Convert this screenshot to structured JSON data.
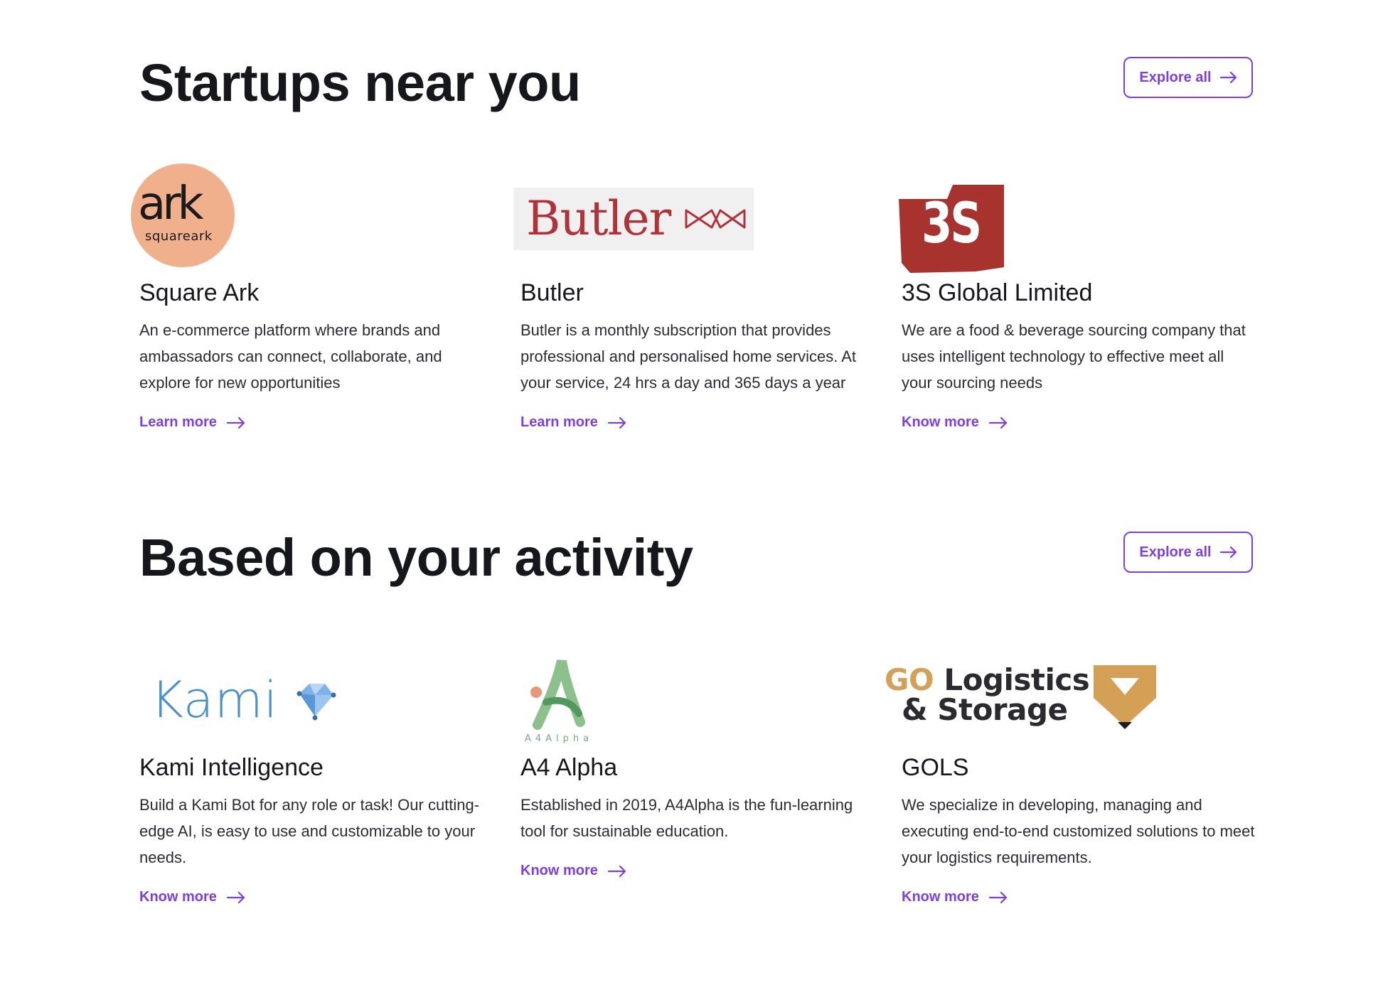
{
  "sections": [
    {
      "title": "Startups near you",
      "explore_label": "Explore all",
      "cards": [
        {
          "logo": {
            "primary": "ark",
            "secondary": "squareark"
          },
          "name": "Square Ark",
          "description": "An e-commerce platform where brands and ambassadors can connect, collaborate, and explore for new opportunities",
          "link_label": "Learn more"
        },
        {
          "logo": {
            "primary": "Butler"
          },
          "name": "Butler",
          "description": "Butler is a monthly subscription that provides professional and personalised home services. At your service, 24 hrs a day and 365 days a year",
          "link_label": "Learn more"
        },
        {
          "logo": {
            "primary": "3S"
          },
          "name": "3S Global Limited",
          "description": "We are a food & beverage sourcing company that uses intelligent technology to effective meet all your sourcing needs",
          "link_label": "Know more"
        }
      ]
    },
    {
      "title": "Based on your activity",
      "explore_label": "Explore all",
      "cards": [
        {
          "logo": {
            "primary": "Kami"
          },
          "name": "Kami Intelligence",
          "description": "Build a Kami Bot for any role or task! Our cutting-edge AI, is easy to use and customizable to your needs.",
          "link_label": "Know more"
        },
        {
          "logo": {
            "primary": "A4Alpha"
          },
          "name": "A4 Alpha",
          "description": "Established in 2019, A4Alpha is the fun-learning tool for sustainable education.",
          "link_label": "Know more"
        },
        {
          "logo": {
            "go": "GO",
            "primary": "Logistics",
            "secondary": "& Storage"
          },
          "name": "GOLS",
          "description": "We specialize in developing, managing and executing end-to-end customized solutions to meet your logistics requirements.",
          "link_label": "Know more"
        }
      ]
    }
  ],
  "colors": {
    "accent": "#7b3fe4",
    "heading": "#16161d",
    "body_text": "#2b2b33",
    "ark_bg": "#f1b08c",
    "butler_red": "#b0333a",
    "ss_red": "#a8332e",
    "kami_blue": "#4a90cc",
    "gols_gold": "#d4a055"
  },
  "icons": {
    "button_arrow": "arrow-right-icon",
    "link_arrow": "arrow-right-icon"
  }
}
